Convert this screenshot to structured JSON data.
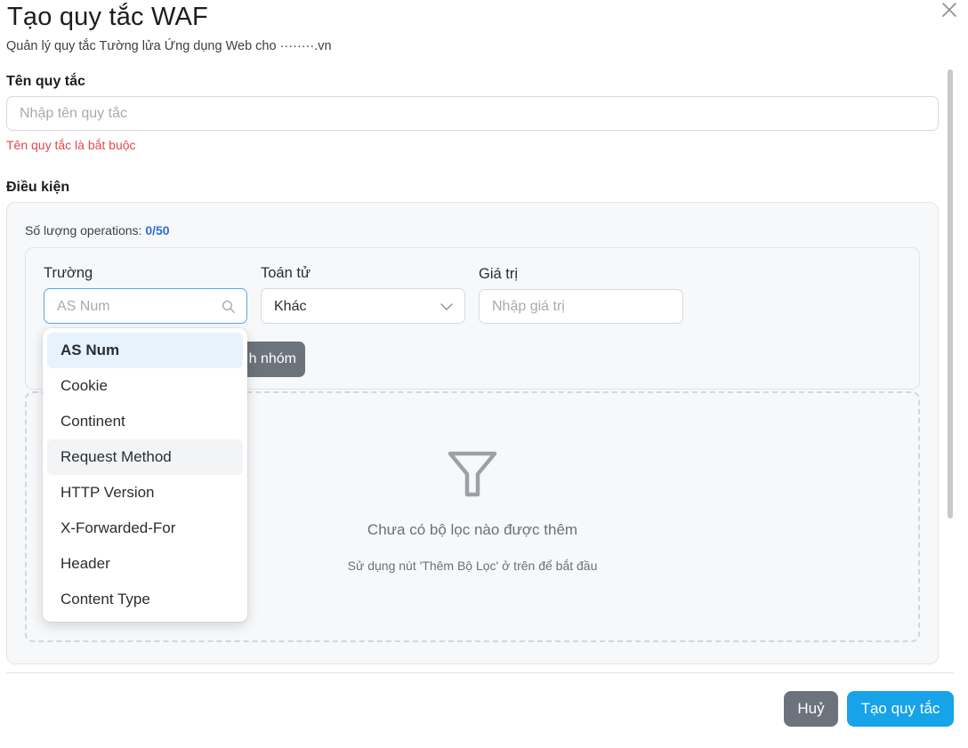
{
  "modal": {
    "title": "Tạo quy tắc WAF",
    "subtitle": "Quản lý quy tắc Tường lửa Ứng dụng Web cho ········.vn"
  },
  "rule_name": {
    "label": "Tên quy tắc",
    "placeholder": "Nhập tên quy tắc",
    "error": "Tên quy tắc là bắt buộc"
  },
  "conditions": {
    "label": "Điều kiện",
    "ops_prefix": "Số lượng operations:",
    "ops_count": "0/50",
    "field_label": "Trường",
    "field_placeholder": "AS Num",
    "operator_label": "Toán tử",
    "operator_value": "Khác",
    "value_label": "Giá trị",
    "value_placeholder": "Nhập giá trị",
    "add_group_label": "h nhóm",
    "empty_title": "Chưa có bộ lọc nào được thêm",
    "empty_hint": "Sử dụng nút 'Thêm Bộ Lọc' ở trên để bắt đầu"
  },
  "dropdown": {
    "selected_index": 0,
    "hovered_index": 3,
    "items": [
      "AS Num",
      "Cookie",
      "Continent",
      "Request Method",
      "HTTP Version",
      "X-Forwarded-For",
      "Header",
      "Content Type"
    ]
  },
  "footer": {
    "cancel_label": "Huỷ",
    "create_label": "Tạo quy tắc"
  },
  "colors": {
    "primary": "#16a3e8",
    "secondary": "#6c737d",
    "error": "#e5484d",
    "count_accent": "#2f6fd6"
  }
}
